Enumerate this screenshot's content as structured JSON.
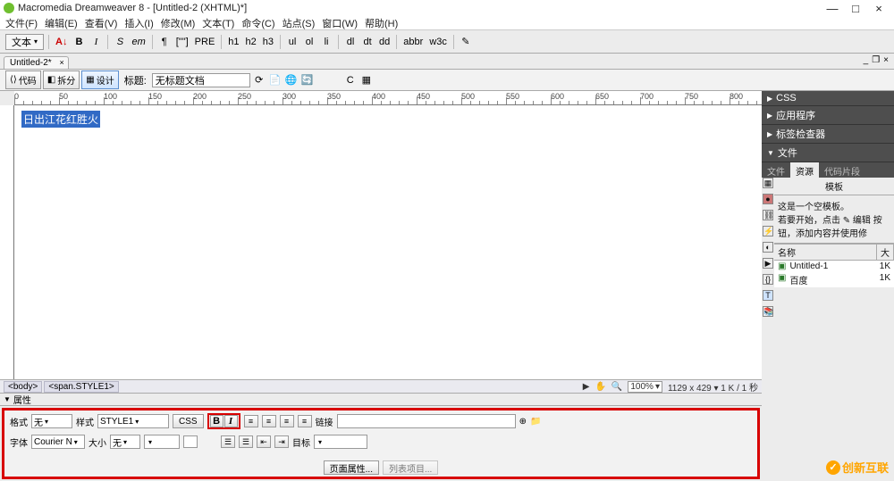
{
  "title": "Macromedia Dreamweaver 8 - [Untitled-2 (XHTML)*]",
  "menu": [
    "文件(F)",
    "编辑(E)",
    "查看(V)",
    "插入(I)",
    "修改(M)",
    "文本(T)",
    "命令(C)",
    "站点(S)",
    "窗口(W)",
    "帮助(H)"
  ],
  "toolbar": {
    "textDropdown": "文本",
    "items": [
      "A↓",
      "B",
      "I",
      "S",
      "em",
      "¶",
      "[\"\"]",
      "PRE",
      "h1",
      "h2",
      "h3",
      "ul",
      "ol",
      "li",
      "dl",
      "dt",
      "dd",
      "abbr",
      "w3c",
      "✎"
    ]
  },
  "doctab": {
    "label": "Untitled-2*",
    "minimize": "_",
    "restore": "❐",
    "close": "×"
  },
  "viewbar": {
    "code": "代码",
    "split": "拆分",
    "design": "设计",
    "titleLabel": "标题:",
    "titleValue": "无标题文档"
  },
  "ruler_h": [
    "0",
    "50",
    "100",
    "150",
    "200",
    "250",
    "300",
    "350",
    "400",
    "450",
    "500",
    "550",
    "600",
    "650",
    "700",
    "750",
    "800"
  ],
  "content_selected": "日出江花红胜火",
  "tagselector": {
    "tags": [
      "<body>",
      "<span.STYLE1>"
    ],
    "zoom": "100%",
    "dims": "1129 x 429 ▾ 1 K / 1 秒"
  },
  "prop": {
    "title": "属性",
    "formatLabel": "格式",
    "formatValue": "无",
    "styleLabel": "样式",
    "styleValue": "STYLE1",
    "cssBtn": "CSS",
    "bold": "B",
    "italic": "I",
    "linkLabel": "链接",
    "linkValue": "",
    "fontLabel": "字体",
    "fontValue": "Courier N",
    "sizeLabel": "大小",
    "sizeValue": "无",
    "targetLabel": "目标",
    "targetValue": "",
    "pageProps": "页面属性...",
    "listItem": "列表项目..."
  },
  "side": {
    "css": "CSS",
    "app": "应用程序",
    "tag": "标签检查器",
    "files": "文件",
    "tabs": {
      "files": "文件",
      "assets": "资源",
      "snippets": "代码片段"
    },
    "templateHeader": "模板",
    "templateMsg": "这是一个空模板。\n若要开始，点击 ✎ 编辑 按钮，添加内容并使用修",
    "cols": {
      "name": "名称",
      "size": "大"
    },
    "rows": [
      {
        "name": "Untitled-1",
        "size": "1K"
      },
      {
        "name": "百度",
        "size": "1K"
      }
    ]
  },
  "watermark": "创新互联"
}
